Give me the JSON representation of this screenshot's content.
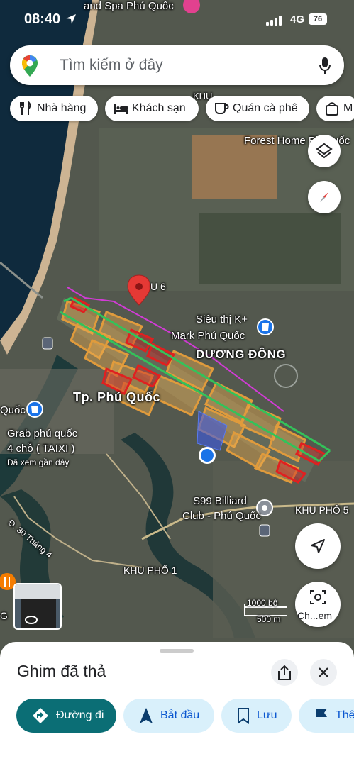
{
  "status_bar": {
    "time": "08:40",
    "network": "4G",
    "battery": "76"
  },
  "search": {
    "placeholder": "Tìm kiếm ở đây"
  },
  "chips": [
    {
      "label": "Nhà hàng",
      "icon": "fork-knife-icon"
    },
    {
      "label": "Khách sạn",
      "icon": "bed-icon"
    },
    {
      "label": "Quán cà phê",
      "icon": "coffee-cup-icon"
    },
    {
      "label": "M",
      "icon": "shopping-bag-icon"
    }
  ],
  "map_labels": {
    "top_resort": "and Spa Phú Quốc",
    "khu": "KHU",
    "forest_home": "Forest Home Ph Quốc",
    "u6": "U 6",
    "sieu_thi_1": "Siêu thị K+",
    "sieu_thi_2": "Mark Phú Quốc",
    "duong_dong": "DƯƠNG ĐÔNG",
    "tp_phu_quoc": "Tp. Phú Quốc",
    "quoc": "Quốc",
    "grab_1": "Grab phú quốc",
    "grab_2": "4 chỗ ( TAIXI )",
    "grab_3": "Đã xem gần đây",
    "street_30_4": "Đ. 30 Tháng 4",
    "s99_1": "S99 Billiard",
    "s99_2": "Club - Phú Quốc",
    "khu_pho_5": "KHU PHỐ 5",
    "khu_pho_1": "KHU PHỐ 1",
    "letter_g": "G",
    "scale_ft": "1000 bộ",
    "scale_m": "500 m",
    "streetview_caption": "Ch...em"
  },
  "sheet": {
    "title": "Ghim đã thả",
    "actions": [
      "Đường đi",
      "Bắt đầu",
      "Lưu",
      "Thê"
    ]
  },
  "colors": {
    "accent": "#0b6e75",
    "action_bg": "#d9f0fb",
    "action_fg": "#0b57d0",
    "pin": "#e53935"
  }
}
